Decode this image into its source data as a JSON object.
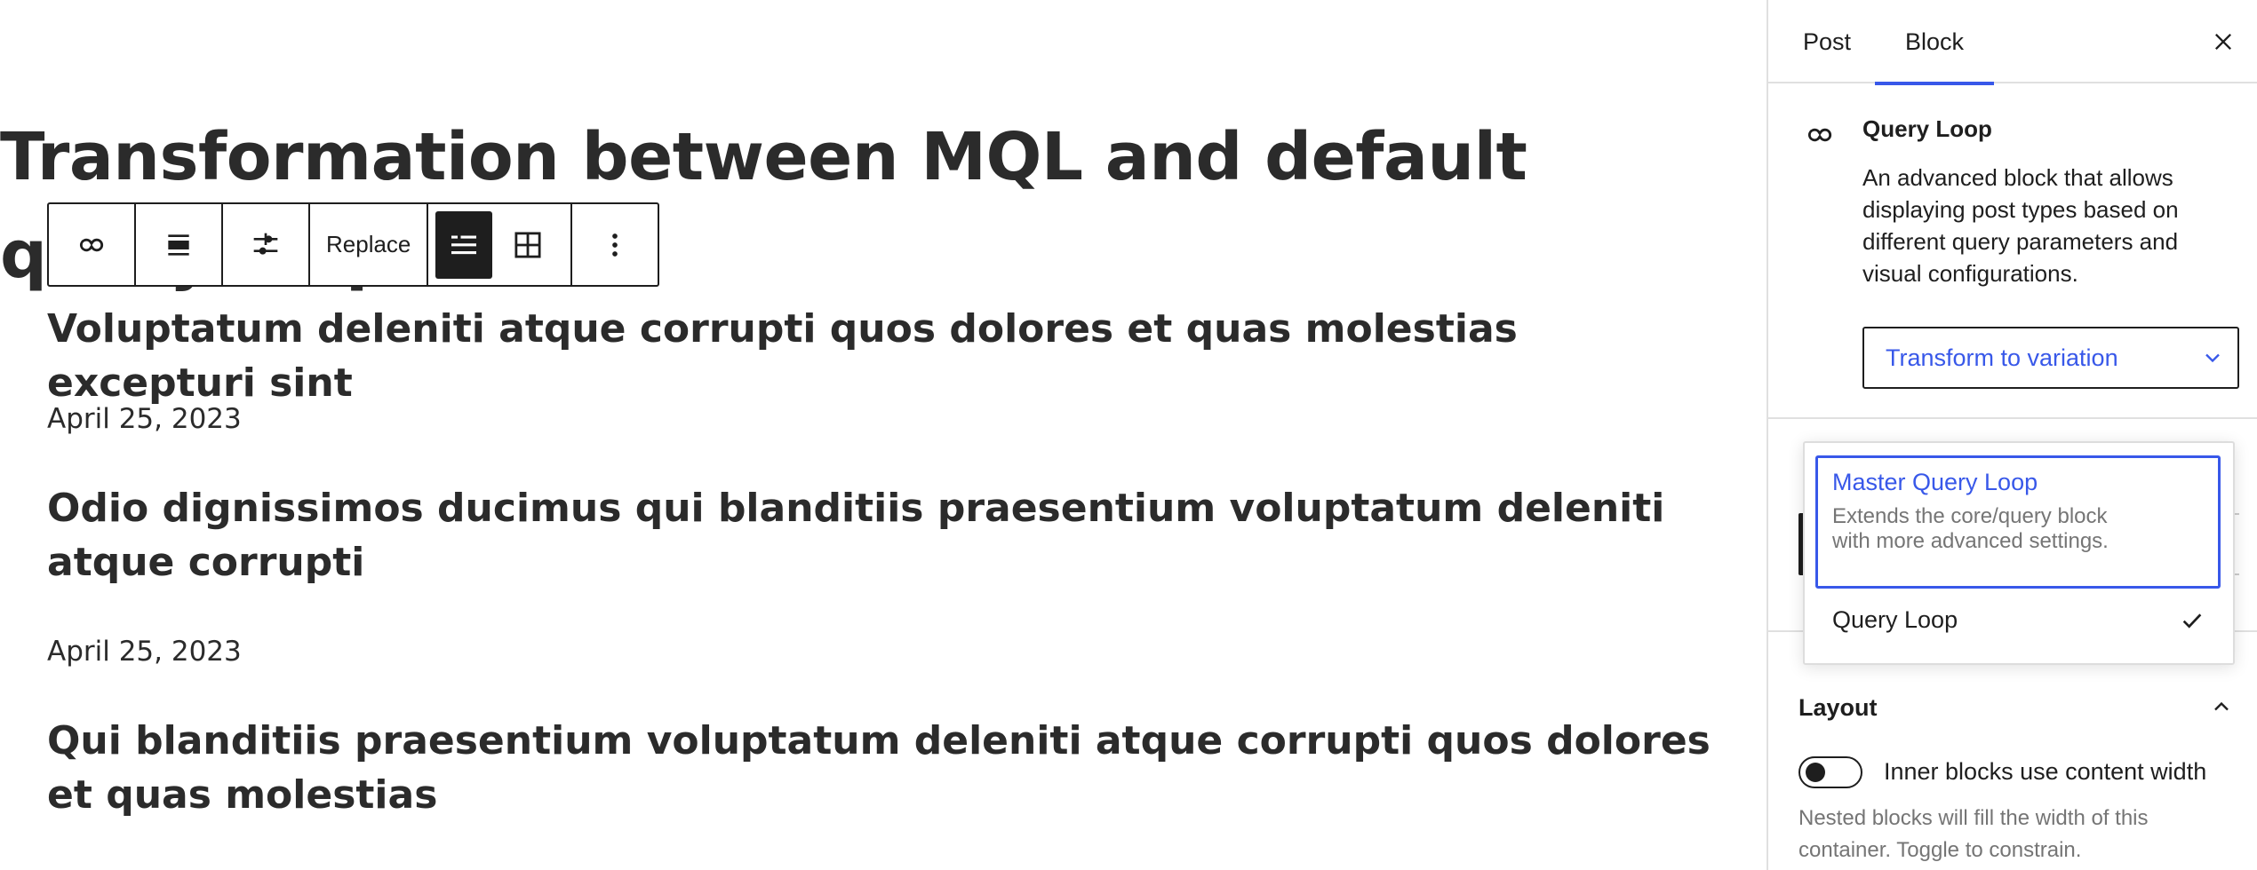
{
  "editor": {
    "page_title": "Transformation between MQL and default query loop",
    "toolbar": {
      "buttons": [
        {
          "name": "query-loop-icon",
          "label": ""
        },
        {
          "name": "align-icon",
          "label": ""
        },
        {
          "name": "settings-sliders-icon",
          "label": ""
        },
        {
          "name": "replace-button",
          "label": "Replace"
        },
        {
          "name": "list-view-icon",
          "label": ""
        },
        {
          "name": "grid-view-icon",
          "label": ""
        },
        {
          "name": "more-options-icon",
          "label": ""
        }
      ],
      "replace_label": "Replace"
    },
    "posts": [
      {
        "title": "Voluptatum deleniti atque corrupti quos dolores et quas molestias excepturi sint",
        "date": "April 25, 2023"
      },
      {
        "title": "Odio dignissimos ducimus qui blanditiis praesentium voluptatum deleniti atque corrupti",
        "date": "April 25, 2023"
      },
      {
        "title": "Qui blanditiis praesentium voluptatum deleniti atque corrupti quos dolores et quas molestias"
      }
    ]
  },
  "sidebar": {
    "tabs": [
      {
        "label": "Post",
        "active": false
      },
      {
        "label": "Block",
        "active": true
      }
    ],
    "block_card": {
      "title": "Query Loop",
      "description": "An advanced block that allows displaying post types based on different query parameters and visual configurations.",
      "transform_label": "Transform to variation"
    },
    "variation_menu": {
      "options": [
        {
          "title": "Master Query Loop",
          "description": "Extends the core/query block with more advanced settings.",
          "highlighted": true,
          "selected": false
        },
        {
          "title": "Query Loop",
          "description": "",
          "highlighted": false,
          "selected": true
        }
      ]
    },
    "layout": {
      "heading": "Layout",
      "toggle_label": "Inner blocks use content width",
      "toggle_on": false,
      "help": "Nested blocks will fill the width of this container. Toggle to constrain."
    }
  },
  "colors": {
    "accent": "#3858e9",
    "text": "#1e1e1e",
    "muted": "#757575",
    "border": "#e0e0e0"
  }
}
